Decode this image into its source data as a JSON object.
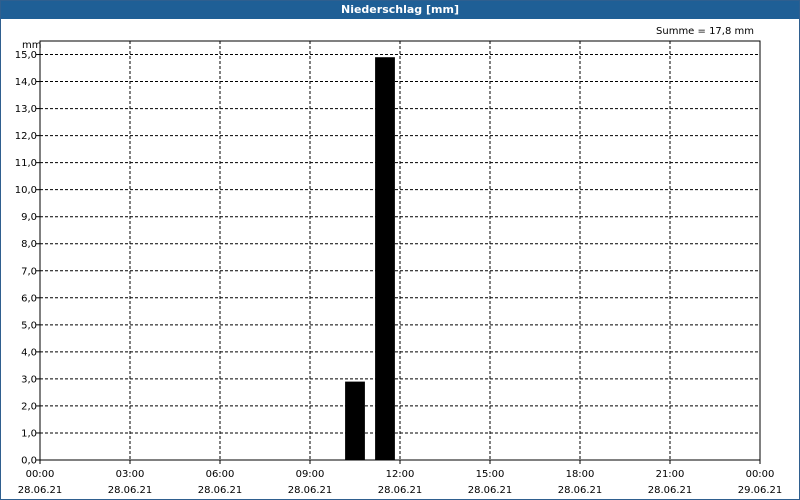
{
  "chart_data": {
    "type": "bar",
    "title": "Niederschlag [mm]",
    "ylabel": "mm",
    "annotation": "Summe = 17,8 mm",
    "ylim": [
      0,
      15.5
    ],
    "yticks": [
      0,
      1,
      2,
      3,
      4,
      5,
      6,
      7,
      8,
      9,
      10,
      11,
      12,
      13,
      14,
      15
    ],
    "ytick_labels": [
      "0,0",
      "1,0",
      "2,0",
      "3,0",
      "4,0",
      "5,0",
      "6,0",
      "7,0",
      "8,0",
      "9,0",
      "10,0",
      "11,0",
      "12,0",
      "13,0",
      "14,0",
      "15,0"
    ],
    "x_range_hours": [
      0,
      24
    ],
    "xticks": [
      {
        "hour": 0,
        "time": "00:00",
        "date": "28.06.21"
      },
      {
        "hour": 3,
        "time": "03:00",
        "date": "28.06.21"
      },
      {
        "hour": 6,
        "time": "06:00",
        "date": "28.06.21"
      },
      {
        "hour": 9,
        "time": "09:00",
        "date": "28.06.21"
      },
      {
        "hour": 12,
        "time": "12:00",
        "date": "28.06.21"
      },
      {
        "hour": 15,
        "time": "15:00",
        "date": "28.06.21"
      },
      {
        "hour": 18,
        "time": "18:00",
        "date": "28.06.21"
      },
      {
        "hour": 21,
        "time": "21:00",
        "date": "28.06.21"
      },
      {
        "hour": 24,
        "time": "00:00",
        "date": "29.06.21"
      }
    ],
    "bars": [
      {
        "start_hour": 10,
        "end_hour": 11,
        "value": 2.9
      },
      {
        "start_hour": 11,
        "end_hour": 12,
        "value": 14.9
      }
    ],
    "grid": true,
    "colors": {
      "bar": "#000000",
      "grid": "#000000",
      "titlebar": "#1f5f96"
    }
  }
}
